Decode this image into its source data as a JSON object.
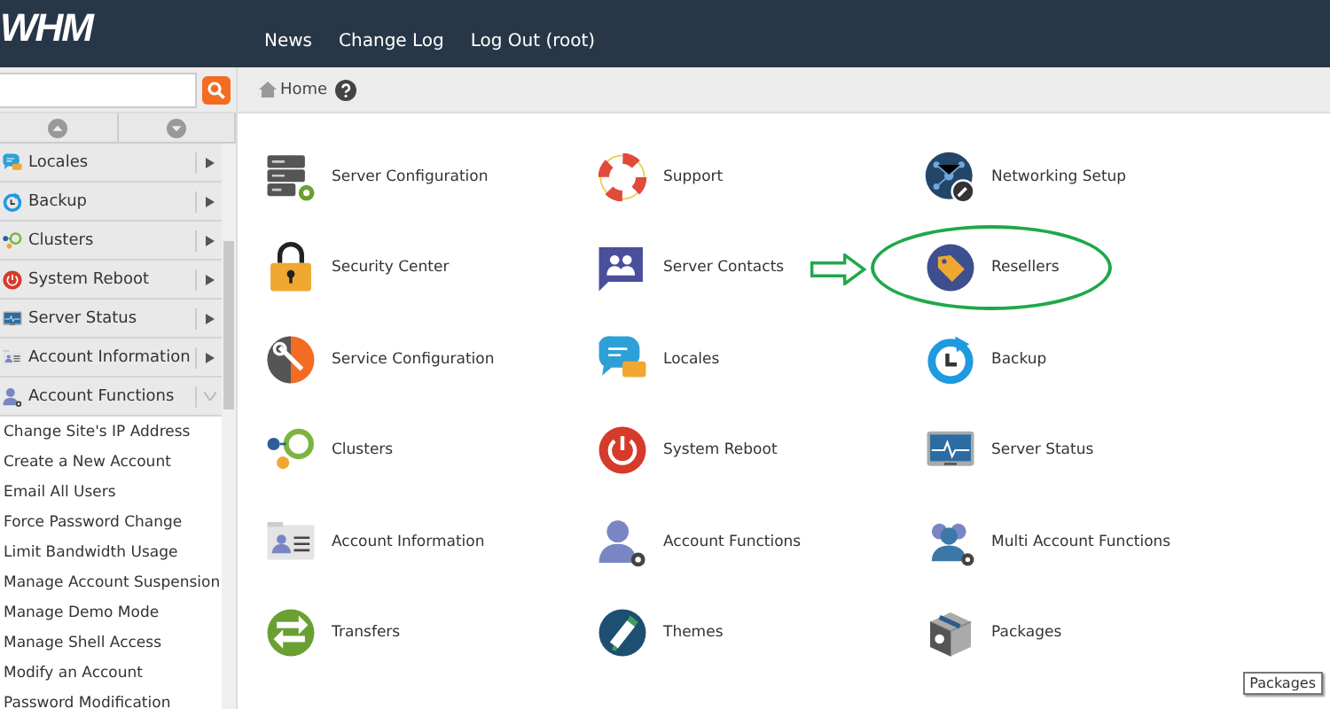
{
  "header": {
    "logo": "WHM",
    "nav": [
      "News",
      "Change Log",
      "Log Out (root)"
    ]
  },
  "breadcrumb": {
    "label": "Home"
  },
  "sidebar": {
    "categories": [
      {
        "label": "Locales",
        "kind": "locales",
        "expanded": false
      },
      {
        "label": "Backup",
        "kind": "backup",
        "expanded": false
      },
      {
        "label": "Clusters",
        "kind": "clusters",
        "expanded": false
      },
      {
        "label": "System Reboot",
        "kind": "reboot",
        "expanded": false
      },
      {
        "label": "Server Status",
        "kind": "status",
        "expanded": false
      },
      {
        "label": "Account Information",
        "kind": "accountinfo",
        "expanded": false
      },
      {
        "label": "Account Functions",
        "kind": "accountfunc",
        "expanded": true,
        "children": [
          {
            "label": "Change Site's IP Address"
          },
          {
            "label": "Create a New Account"
          },
          {
            "label": "Email All Users"
          },
          {
            "label": "Force Password Change"
          },
          {
            "label": "Limit Bandwidth Usage"
          },
          {
            "label": "Manage Account Suspension"
          },
          {
            "label": "Manage Demo Mode"
          },
          {
            "label": "Manage Shell Access"
          },
          {
            "label": "Modify an Account"
          },
          {
            "label": "Password Modification"
          }
        ]
      }
    ]
  },
  "grid": [
    {
      "label": "Server Configuration",
      "kind": "serverconfig",
      "annotated": false
    },
    {
      "label": "Support",
      "kind": "support",
      "annotated": false
    },
    {
      "label": "Networking Setup",
      "kind": "network",
      "annotated": false
    },
    {
      "label": "Security Center",
      "kind": "security",
      "annotated": false
    },
    {
      "label": "Server Contacts",
      "kind": "contacts",
      "annotated": false
    },
    {
      "label": "Resellers",
      "kind": "resellers",
      "annotated": true
    },
    {
      "label": "Service Configuration",
      "kind": "serviceconfig",
      "annotated": false
    },
    {
      "label": "Locales",
      "kind": "locales",
      "annotated": false
    },
    {
      "label": "Backup",
      "kind": "backup",
      "annotated": false
    },
    {
      "label": "Clusters",
      "kind": "clusters",
      "annotated": false
    },
    {
      "label": "System Reboot",
      "kind": "reboot",
      "annotated": false
    },
    {
      "label": "Server Status",
      "kind": "status",
      "annotated": false
    },
    {
      "label": "Account Information",
      "kind": "accountinfo",
      "annotated": false
    },
    {
      "label": "Account Functions",
      "kind": "accountfunc",
      "annotated": false
    },
    {
      "label": "Multi Account Functions",
      "kind": "multiaccount",
      "annotated": false
    },
    {
      "label": "Transfers",
      "kind": "transfers",
      "annotated": false
    },
    {
      "label": "Themes",
      "kind": "themes",
      "annotated": false
    },
    {
      "label": "Packages",
      "kind": "packages",
      "annotated": false
    }
  ],
  "tooltip": {
    "text": "Packages"
  }
}
